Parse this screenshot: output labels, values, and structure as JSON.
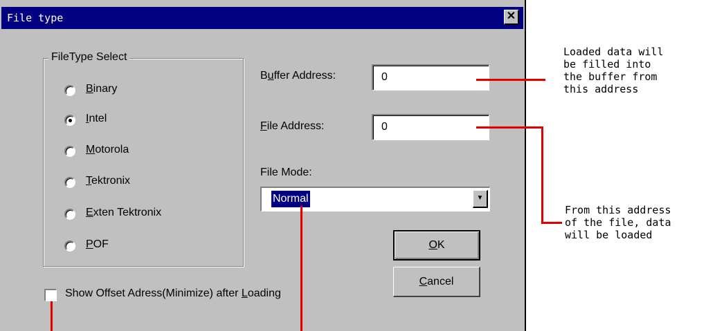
{
  "dialog": {
    "title": "File type",
    "close_glyph": "✕"
  },
  "filetype_group": {
    "legend": "FileType Select",
    "options": [
      {
        "pre": "",
        "accel": "B",
        "post": "inary",
        "selected": false
      },
      {
        "pre": "",
        "accel": "I",
        "post": "ntel",
        "selected": true
      },
      {
        "pre": "",
        "accel": "M",
        "post": "otorola",
        "selected": false
      },
      {
        "pre": "",
        "accel": "T",
        "post": "ektronix",
        "selected": false
      },
      {
        "pre": "",
        "accel": "E",
        "post": "xten Tektronix",
        "selected": false
      },
      {
        "pre": "",
        "accel": "P",
        "post": "OF",
        "selected": false
      }
    ]
  },
  "buffer_address": {
    "label_pre": "B",
    "label_accel": "u",
    "label_post": "ffer Address:",
    "value": "0"
  },
  "file_address": {
    "label_pre": "",
    "label_accel": "F",
    "label_post": "ile Address:",
    "value": "0"
  },
  "file_mode": {
    "label": "File Mode:",
    "value": "Normal"
  },
  "buttons": {
    "ok": {
      "accel": "O",
      "post": "K"
    },
    "cancel": {
      "accel": "C",
      "post": "ancel"
    }
  },
  "checkbox": {
    "label_pre": "Show Offset Adress(Minimize) after ",
    "label_accel": "L",
    "label_post": "oading",
    "checked": false
  },
  "annotations": {
    "buffer": "Loaded data will\nbe filled into\nthe buffer from\nthis address",
    "file": "From this address\nof the file, data\nwill be loaded"
  },
  "colors": {
    "annotation_line": "#e00000",
    "titlebar": "#000080",
    "dialog_bg": "#c0c0c0"
  }
}
